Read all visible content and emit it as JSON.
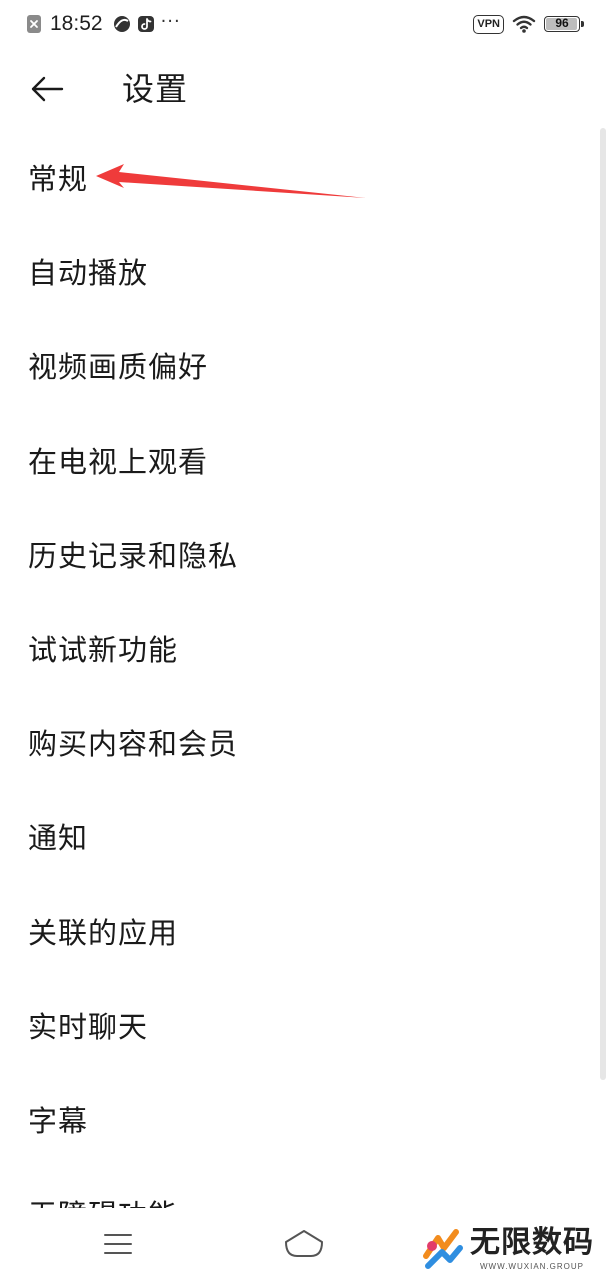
{
  "status_bar": {
    "time": "18:52",
    "dots": "···",
    "vpn": "VPN",
    "battery": "96",
    "battery_level": 0.96,
    "icons": [
      "close-notification-icon",
      "browser-icon",
      "tiktok-icon",
      "wifi-icon"
    ]
  },
  "header": {
    "title": "设置",
    "back_icon": "arrow-left-icon"
  },
  "settings": {
    "items": [
      {
        "label": "常规"
      },
      {
        "label": "自动播放"
      },
      {
        "label": "视频画质偏好"
      },
      {
        "label": "在电视上观看"
      },
      {
        "label": "历史记录和隐私"
      },
      {
        "label": "试试新功能"
      },
      {
        "label": "购买内容和会员"
      },
      {
        "label": "通知"
      },
      {
        "label": "关联的应用"
      },
      {
        "label": "实时聊天"
      },
      {
        "label": "字幕"
      },
      {
        "label": "无障碍功能"
      }
    ]
  },
  "annotation": {
    "color": "#ef3b3b",
    "target": "常规"
  },
  "nav": {
    "menu_icon": "menu-icon",
    "home_icon": "home-icon"
  },
  "watermark": {
    "title": "无限数码",
    "subtitle": "WWW.WUXIAN.GROUP"
  }
}
